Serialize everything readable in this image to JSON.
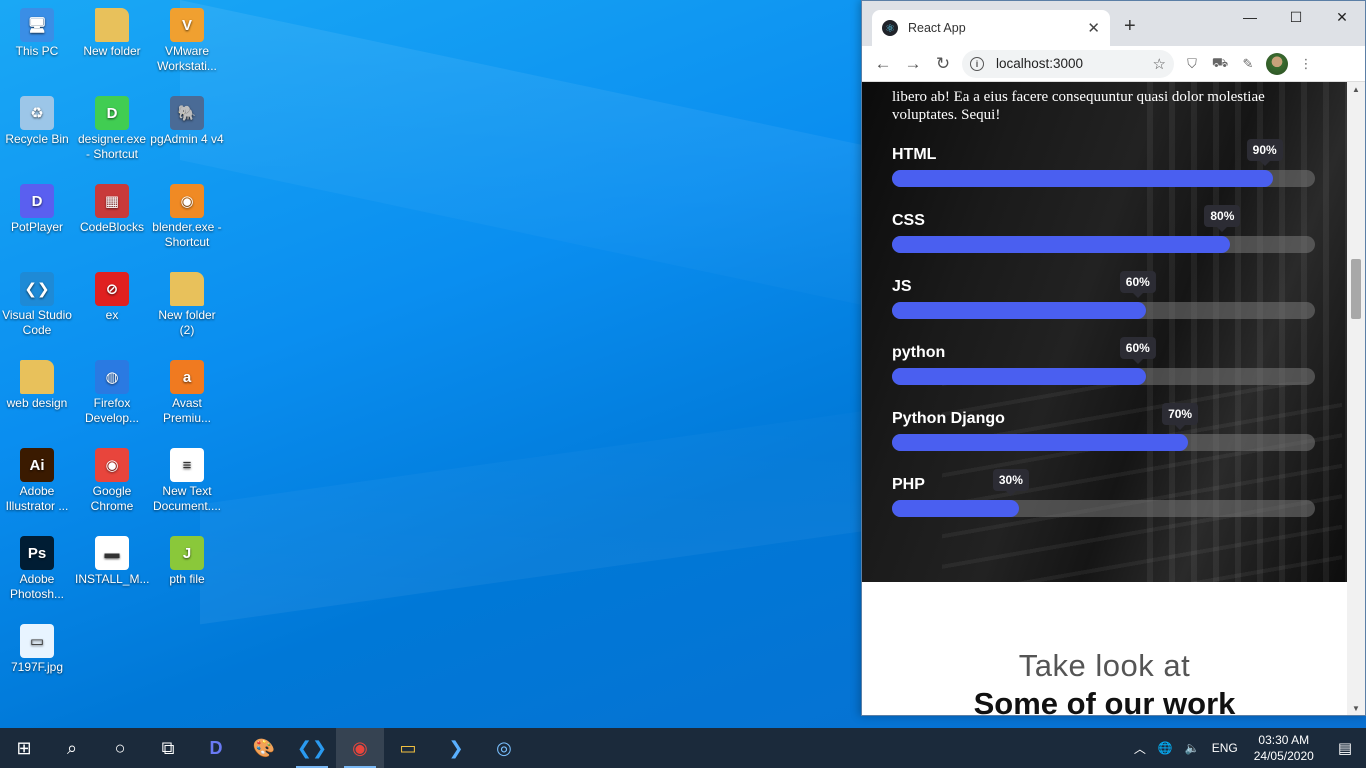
{
  "desktop": {
    "icons": [
      {
        "label": "This PC",
        "icon": "computer-icon",
        "color": "#3a8ee6"
      },
      {
        "label": "New folder",
        "icon": "folder-icon",
        "color": "#e8c15b"
      },
      {
        "label": "VMware Workstati...",
        "icon": "vmware-icon",
        "color": "#f0a030"
      },
      {
        "label": "Recycle Bin",
        "icon": "recycle-bin-icon",
        "color": "#9cc6e8"
      },
      {
        "label": "designer.exe - Shortcut",
        "icon": "qt-designer-icon",
        "color": "#41cd52"
      },
      {
        "label": "pgAdmin 4 v4",
        "icon": "pgadmin-icon",
        "color": "#4a6b96"
      },
      {
        "label": "PotPlayer",
        "icon": "potplayer-icon",
        "color": "#5a5ff0"
      },
      {
        "label": "CodeBlocks",
        "icon": "codeblocks-icon",
        "color": "#c83a3a"
      },
      {
        "label": "blender.exe - Shortcut",
        "icon": "blender-icon",
        "color": "#f08a24"
      },
      {
        "label": "Visual Studio Code",
        "icon": "vscode-icon",
        "color": "#1e8ad6"
      },
      {
        "label": "ex",
        "icon": "prohibited-icon",
        "color": "#e02020"
      },
      {
        "label": "New folder (2)",
        "icon": "folder-icon",
        "color": "#e8c15b"
      },
      {
        "label": "web design",
        "icon": "folder-icon",
        "color": "#e8c15b"
      },
      {
        "label": "Firefox Develop...",
        "icon": "firefox-icon",
        "color": "#2a7ae2"
      },
      {
        "label": "Avast Premiu...",
        "icon": "avast-icon",
        "color": "#f07a20"
      },
      {
        "label": "Adobe Illustrator ...",
        "icon": "illustrator-icon",
        "color": "#3a1a00"
      },
      {
        "label": "Google Chrome",
        "icon": "chrome-icon",
        "color": "#e8453c"
      },
      {
        "label": "New Text Document....",
        "icon": "text-file-icon",
        "color": "#ffffff"
      },
      {
        "label": "Adobe Photosh...",
        "icon": "photoshop-icon",
        "color": "#001d34"
      },
      {
        "label": "INSTALL_M...",
        "icon": "installer-icon",
        "color": "#ffffff"
      },
      {
        "label": "pth file",
        "icon": "pth-file-icon",
        "color": "#8ac83a"
      },
      {
        "label": "7197F.jpg",
        "icon": "image-file-icon",
        "color": "#e8f4ff"
      }
    ]
  },
  "browser": {
    "tab_title": "React App",
    "tab_favicon": "react-icon",
    "url": "localhost:3000",
    "page": {
      "paragraph": "libero ab! Ea a eius facere consequuntur quasi dolor molestiae voluptates. Sequi!",
      "skills": [
        {
          "name": "HTML",
          "percent": 90,
          "label": "90%"
        },
        {
          "name": "CSS",
          "percent": 80,
          "label": "80%"
        },
        {
          "name": "JS",
          "percent": 60,
          "label": "60%"
        },
        {
          "name": "python",
          "percent": 60,
          "label": "60%"
        },
        {
          "name": "Python Django",
          "percent": 70,
          "label": "70%"
        },
        {
          "name": "PHP",
          "percent": 30,
          "label": "30%"
        }
      ],
      "work_subtitle": "Take look at",
      "work_title": "Some of our work"
    }
  },
  "taskbar": {
    "apps": [
      "start-icon",
      "search-icon",
      "cortana-icon",
      "task-view-icon",
      "potplayer-icon",
      "paint-icon",
      "vscode-icon",
      "chrome-icon",
      "file-explorer-icon",
      "powershell-icon",
      "zoom-icon"
    ],
    "language": "ENG",
    "time": "03:30 AM",
    "date": "24/05/2020"
  }
}
